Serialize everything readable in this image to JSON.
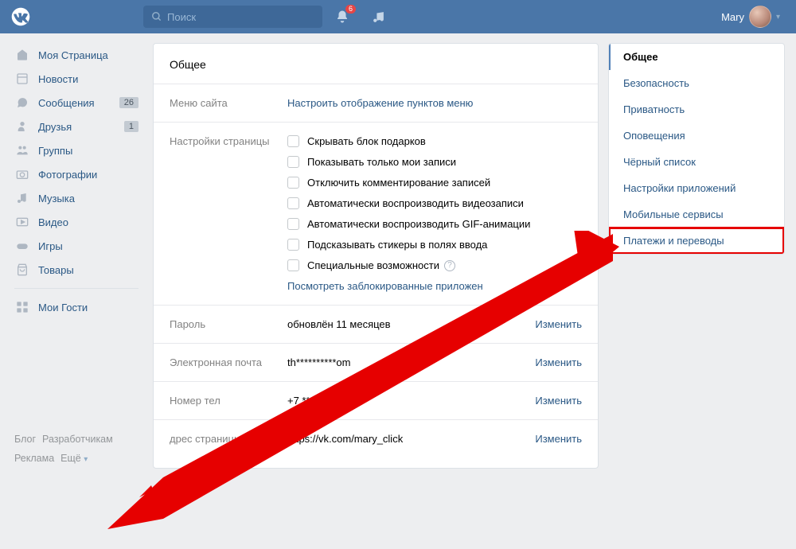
{
  "header": {
    "search_placeholder": "Поиск",
    "notif_count": "6",
    "user_name": "Mary"
  },
  "sidebar": {
    "items": [
      {
        "label": "Моя Страница",
        "icon": "home"
      },
      {
        "label": "Новости",
        "icon": "feed"
      },
      {
        "label": "Сообщения",
        "icon": "messages",
        "badge": "26"
      },
      {
        "label": "Друзья",
        "icon": "friends",
        "badge": "1"
      },
      {
        "label": "Группы",
        "icon": "groups"
      },
      {
        "label": "Фотографии",
        "icon": "photos"
      },
      {
        "label": "Музыка",
        "icon": "music"
      },
      {
        "label": "Видео",
        "icon": "video"
      },
      {
        "label": "Игры",
        "icon": "games"
      },
      {
        "label": "Товары",
        "icon": "market"
      }
    ],
    "guests_label": "Мои Гости"
  },
  "footer": {
    "blog": "Блог",
    "devs": "Разработчикам",
    "ads": "Реклама",
    "more": "Ещё"
  },
  "main": {
    "title": "Общее",
    "menu_section": {
      "label": "Меню сайта",
      "link": "Настроить отображение пунктов меню"
    },
    "page_settings": {
      "label": "Настройки страницы",
      "checkboxes": [
        "Скрывать блок подарков",
        "Показывать только мои записи",
        "Отключить комментирование записей",
        "Автоматически воспроизводить видеозаписи",
        "Автоматически воспроизводить GIF-анимации",
        "Подсказывать стикеры в полях ввода",
        "Специальные возможности"
      ],
      "blocked_link": "Посмотреть заблокированные приложен"
    },
    "password": {
      "label": "Пароль",
      "value": "обновлён 11 месяцев",
      "action": "Изменить"
    },
    "email": {
      "label": "Электронная почта",
      "value": "th**********om",
      "action": "Изменить"
    },
    "phone": {
      "label": "Номер тел",
      "value": "+7 *** *** ** 15",
      "action": "Изменить"
    },
    "address": {
      "label": "дрес страницы",
      "value": "https://vk.com/mary_click",
      "action": "Изменить"
    }
  },
  "tabs": [
    "Общее",
    "Безопасность",
    "Приватность",
    "Оповещения",
    "Чёрный список",
    "Настройки приложений",
    "Мобильные сервисы",
    "Платежи и переводы"
  ]
}
